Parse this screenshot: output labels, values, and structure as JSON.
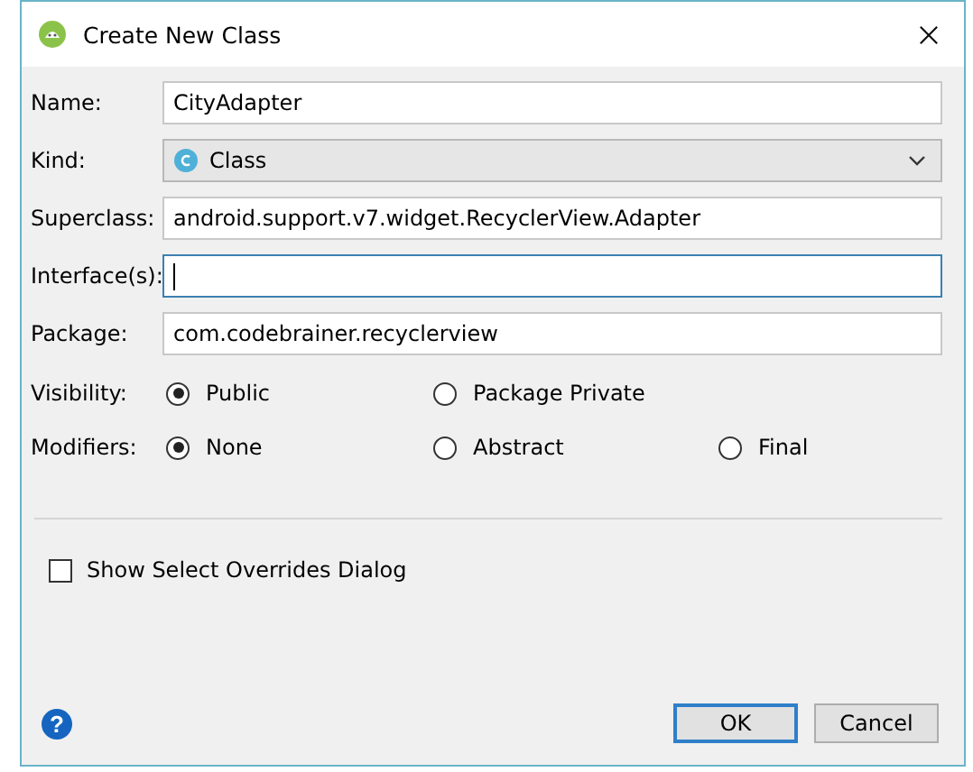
{
  "window": {
    "title": "Create New Class"
  },
  "fields": [
    {
      "label": "Name:",
      "kind": "text",
      "value": "CityAdapter",
      "focused": false
    },
    {
      "label": "Kind:",
      "kind": "dropdown",
      "value": "Class"
    },
    {
      "label": "Superclass:",
      "kind": "text",
      "value": "android.support.v7.widget.RecyclerView.Adapter",
      "focused": false
    },
    {
      "label": "Interface(s):",
      "kind": "text",
      "focused": true
    },
    {
      "label": "Package:",
      "kind": "text",
      "value": "com.codebrainer.recyclerview",
      "focused": false
    }
  ],
  "radio_groups": [
    {
      "label": "Visibility:",
      "options": [
        {
          "label": "Public",
          "selected": true
        },
        {
          "label": "Package Private",
          "selected": false
        }
      ]
    },
    {
      "label": "Modifiers:",
      "options": [
        {
          "label": "None",
          "selected": true
        },
        {
          "label": "Abstract",
          "selected": false
        },
        {
          "label": "Final",
          "selected": false
        }
      ]
    }
  ],
  "checkbox": {
    "label": "Show Select Overrides Dialog",
    "checked": false
  },
  "help": {
    "glyph": "?"
  },
  "buttons": [
    {
      "label": "OK",
      "default": true
    },
    {
      "label": "Cancel",
      "default": false
    }
  ]
}
